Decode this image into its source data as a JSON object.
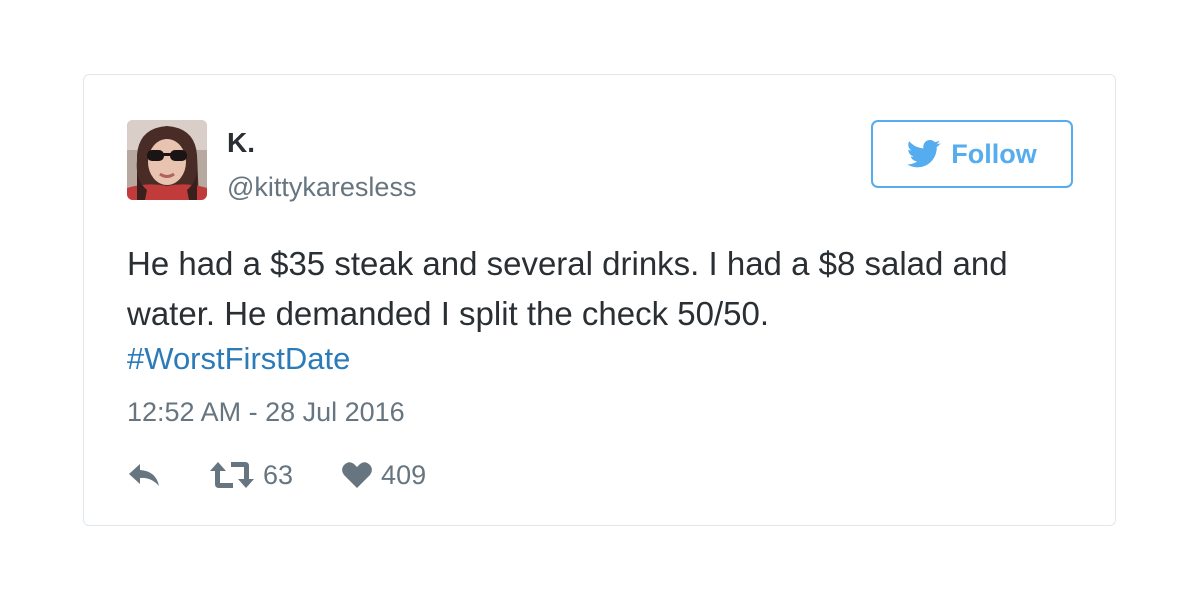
{
  "tweet": {
    "display_name": "K.",
    "handle": "@kittykaresless",
    "text": "He had a $35 steak and several drinks. I had a $8 salad and water. He demanded I split the check 50/50.",
    "hashtag": "#WorstFirstDate",
    "timestamp": "12:52 AM - 28 Jul 2016",
    "follow_label": "Follow",
    "retweet_count": "63",
    "like_count": "409"
  },
  "icons": {
    "follow": "twitter-bird-icon",
    "reply": "reply-icon",
    "retweet": "retweet-icon",
    "like": "heart-icon"
  },
  "colors": {
    "accent": "#55acee",
    "hashtag": "#2b7bb9",
    "text": "#292f33",
    "muted": "#66757f",
    "border": "#e1e8ed"
  }
}
